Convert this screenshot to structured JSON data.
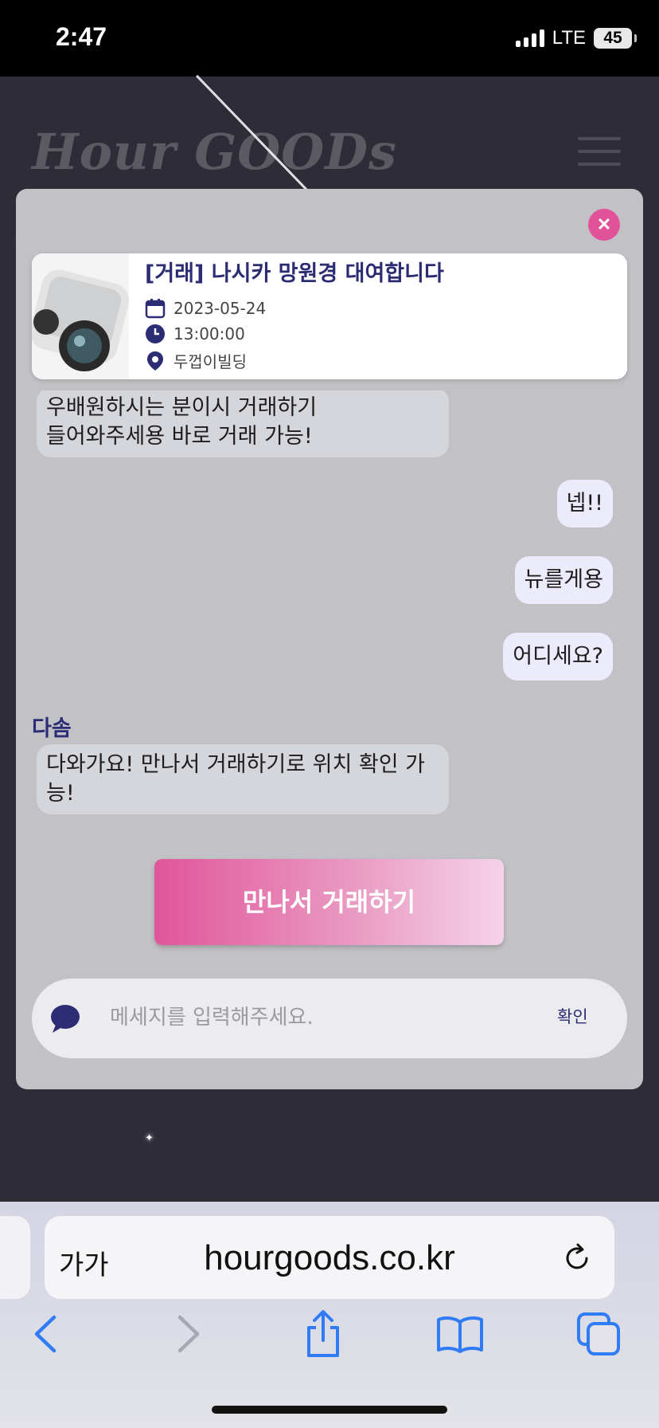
{
  "status_bar": {
    "time": "2:47",
    "network": "LTE",
    "battery": "45"
  },
  "site": {
    "logo": "Hour GOODs"
  },
  "trade_card": {
    "title": "[거래] 나시카 망원경 대여합니다",
    "date": "2023-05-24",
    "time": "13:00:00",
    "location": "두껍이빌딩"
  },
  "chat": {
    "partial_message_line1": "우배원하시는 분이시 거래하기",
    "partial_message_line2": "들어와주세용 바로 거래 가능!",
    "sent_messages": [
      "넵!!",
      "뉴를게용",
      "어디세요?"
    ],
    "sender_name": "다솜",
    "last_message": "다와가요! 만나서 거래하기로 위치 확인 가능!"
  },
  "trade_button": "만나서 거래하기",
  "message_input": {
    "placeholder": "메세지를 입력해주세요.",
    "value": "",
    "confirm": "확인"
  },
  "browser": {
    "text_size": "가가",
    "url": "hourgoods.co.kr"
  },
  "colors": {
    "accent_pink": "#e0539a",
    "navy": "#2b2c74",
    "modal_bg": "#c2c2c6"
  }
}
